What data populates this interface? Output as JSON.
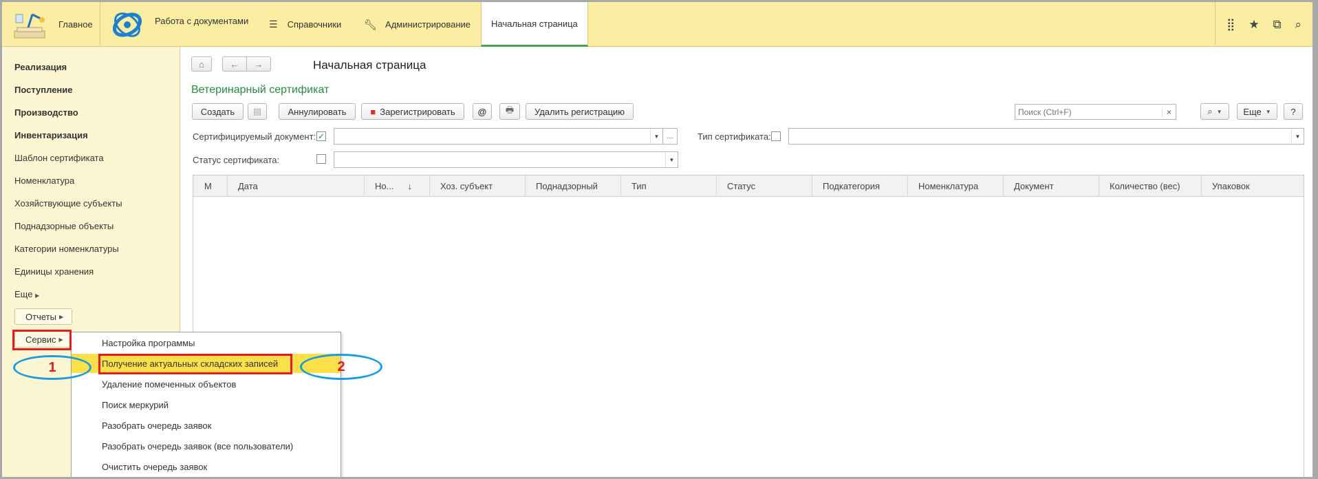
{
  "topbar": {
    "main": "Главное",
    "docs": "Работа с документами",
    "refs": "Справочники",
    "admin": "Администрирование",
    "start": "Начальная страница",
    "icons": [
      "apps-grid-icon",
      "star-icon",
      "history-icon",
      "search-icon"
    ]
  },
  "sidebar": {
    "items": [
      {
        "label": "Реализация",
        "bold": true
      },
      {
        "label": "Поступление",
        "bold": true
      },
      {
        "label": "Производство",
        "bold": true
      },
      {
        "label": "Инвентаризация",
        "bold": true
      },
      {
        "label": "Шаблон сертификата"
      },
      {
        "label": "Номенклатура"
      },
      {
        "label": "Хозяйствующие субъекты"
      },
      {
        "label": "Поднадзорные объекты"
      },
      {
        "label": "Категории номенклатуры"
      },
      {
        "label": "Единицы хранения"
      },
      {
        "label": "Еще"
      }
    ],
    "reports": "Отчеты",
    "service": "Сервис"
  },
  "menu": {
    "items": [
      "Настройка программы",
      "Получение актуальных складских записей",
      "Удаление помеченных объектов",
      "Поиск меркурий",
      "Разобрать очередь заявок",
      "Разобрать очередь заявок (все пользователи)",
      "Очистить очередь заявок"
    ],
    "highlighted_index": 1
  },
  "main": {
    "page_title": "Начальная страница",
    "form_title": "Ветеринарный сертификат",
    "toolbar": {
      "create": "Создать",
      "annul": "Аннулировать",
      "register": "Зарегистрировать",
      "delete_reg": "Удалить регистрацию",
      "email": "@",
      "more": "Еще",
      "help": "?"
    },
    "search_placeholder": "Поиск (Ctrl+F)",
    "filters": {
      "cert_doc": "Сертифицируемый документ:",
      "cert_doc_checked": true,
      "cert_type": "Тип сертификата:",
      "cert_type_checked": false,
      "cert_status": "Статус сертификата:",
      "cert_status_checked": false,
      "ellipsis": "..."
    },
    "columns": [
      "М",
      "Дата",
      "Но...",
      "Хоз. субъект",
      "Поднадзорный",
      "Тип",
      "Статус",
      "Подкатегория",
      "Номенклатура",
      "Документ",
      "Количество (вес)",
      "Упаковок"
    ]
  },
  "annotations": {
    "label1": "1",
    "label2": "2",
    "box_color": "#e11d1d",
    "ellipse_color": "#1a9de0"
  }
}
